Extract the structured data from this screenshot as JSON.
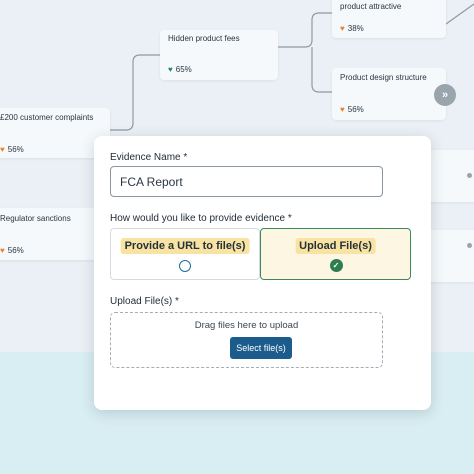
{
  "mindmap": {
    "nodes": [
      {
        "title": "product attractive",
        "score": "38%",
        "heart": "orange-heart-icon"
      },
      {
        "title": "Hidden product fees",
        "score": "65%",
        "heart": "green-heart-icon"
      },
      {
        "title": "Product design structure",
        "score": "56%",
        "heart": "orange-heart-icon"
      },
      {
        "title": "£200 customer complaints",
        "score": "56%",
        "heart": "orange-heart-icon"
      },
      {
        "title": "Regulator sanctions",
        "score": "56%",
        "heart": "orange-heart-icon"
      }
    ],
    "expand_icon": "chevron-double-right-icon"
  },
  "form": {
    "evidence_name_label": "Evidence Name *",
    "evidence_name_value": "FCA Report",
    "provide_question": "How would you like to provide evidence *",
    "options": [
      {
        "label": "Provide a URL to file(s)",
        "selected": false
      },
      {
        "label": "Upload File(s)",
        "selected": true
      }
    ],
    "upload_label": "Upload File(s) *",
    "drop_hint": "Drag files here to upload",
    "select_button": "Select file(s)"
  },
  "colors": {
    "accent": "#1b5c8c",
    "selected_border": "#3b8a5c",
    "tag_bg": "#f9e3a2",
    "orange_heart": "#e8842c",
    "green_heart": "#2e8a5a"
  }
}
